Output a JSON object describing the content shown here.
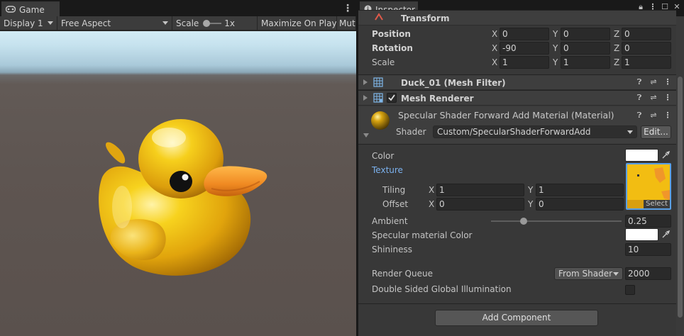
{
  "game_panel": {
    "tab_label": "Game",
    "toolbar": {
      "display": "Display 1",
      "aspect": "Free Aspect",
      "scale_label": "Scale",
      "scale_value": "1x",
      "maximize": "Maximize On Play",
      "mute": "Mute Audio"
    }
  },
  "inspector": {
    "tab_label": "Inspector",
    "transform": {
      "title": "Transform",
      "position": {
        "label": "Position",
        "x": "0",
        "y": "0",
        "z": "0"
      },
      "rotation": {
        "label": "Rotation",
        "x": "-90",
        "y": "0",
        "z": "0"
      },
      "scale": {
        "label": "Scale",
        "x": "1",
        "y": "1",
        "z": "1"
      }
    },
    "axis_labels": {
      "x": "X",
      "y": "Y",
      "z": "Z"
    },
    "mesh_filter": {
      "title": "Duck_01 (Mesh Filter)"
    },
    "mesh_renderer": {
      "title": "Mesh Renderer",
      "enabled": true
    },
    "material": {
      "title": "Specular Shader Forward Add Material (Material)",
      "shader_label": "Shader",
      "shader_value": "Custom/SpecularShaderForwardAdd",
      "edit_button": "Edit...",
      "color_label": "Color",
      "color_value": "#ffffff",
      "texture_label": "Texture",
      "texture_select": "Select",
      "tiling": {
        "label": "Tiling",
        "x": "1",
        "y": "1"
      },
      "offset": {
        "label": "Offset",
        "x": "0",
        "y": "0"
      },
      "ambient": {
        "label": "Ambient",
        "value": "0.25",
        "slider_fraction": 0.25
      },
      "specular_color_label": "Specular material Color",
      "specular_color_value": "#ffffff",
      "shininess": {
        "label": "Shininess",
        "value": "10"
      },
      "render_queue": {
        "label": "Render Queue",
        "mode": "From Shader",
        "value": "2000"
      },
      "double_sided_gi": {
        "label": "Double Sided Global Illumination",
        "checked": false
      }
    },
    "add_component": "Add Component"
  },
  "colors": {
    "accent_link": "#7bb1ee",
    "duck_yellow": "#f2bd12",
    "beak_orange": "#f0962a"
  }
}
